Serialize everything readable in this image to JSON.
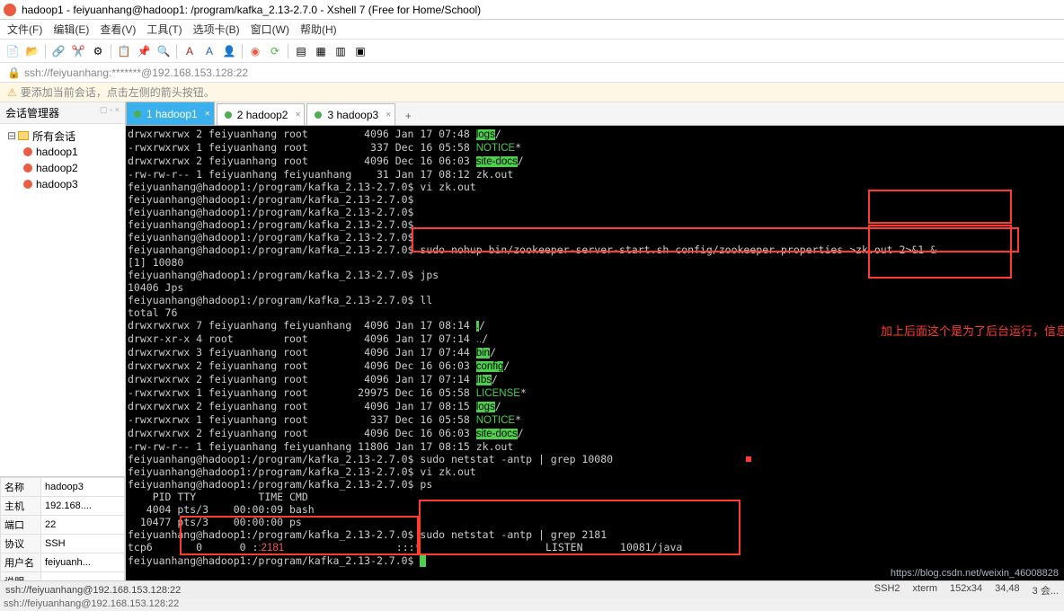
{
  "window": {
    "title": "hadoop1 - feiyuanhang@hadoop1: /program/kafka_2.13-2.7.0 - Xshell 7 (Free for Home/School)"
  },
  "menu": [
    "文件(F)",
    "编辑(E)",
    "查看(V)",
    "工具(T)",
    "选项卡(B)",
    "窗口(W)",
    "帮助(H)"
  ],
  "address": "ssh://feiyuanhang:*******@192.168.153.128:22",
  "hint": "要添加当前会话，点击左侧的箭头按钮。",
  "sidebar": {
    "title": "会话管理器",
    "root": "所有会话",
    "items": [
      "hadoop1",
      "hadoop2",
      "hadoop3"
    ]
  },
  "props": {
    "labels": {
      "name": "名称",
      "host": "主机",
      "port": "端口",
      "protocol": "协议",
      "user": "用户名",
      "desc": "说明"
    },
    "name": "hadoop3",
    "host": "192.168....",
    "port": "22",
    "protocol": "SSH",
    "user": "feiyuanh...",
    "desc": ""
  },
  "tabs": [
    {
      "label": "1 hadoop1",
      "active": true
    },
    {
      "label": "2 hadoop2",
      "active": false
    },
    {
      "label": "3 hadoop3",
      "active": false
    }
  ],
  "note": "加上后面这个是为了后台运行，信息存到out文件，如果失败就去里面查看原因",
  "terminal_lines": [
    [
      {
        "t": "drwxrwxrwx 2 feiyuanhang root         4096 Jan 17 07:48 "
      },
      {
        "t": "logs",
        "c": "gbg"
      },
      {
        "t": "/"
      }
    ],
    [
      {
        "t": "-rwxrwxrwx 1 feiyuanhang root          337 Dec 16 05:58 "
      },
      {
        "t": "NOTICE",
        "c": "g"
      },
      {
        "t": "*"
      }
    ],
    [
      {
        "t": "drwxrwxrwx 2 feiyuanhang root         4096 Dec 16 06:03 "
      },
      {
        "t": "site-docs",
        "c": "gbg"
      },
      {
        "t": "/"
      }
    ],
    [
      {
        "t": "-rw-rw-r-- 1 feiyuanhang feiyuanhang    31 Jan 17 08:12 zk.out"
      }
    ],
    [
      {
        "t": "feiyuanhang@hadoop1:/program/kafka_2.13-2.7.0$ vi zk.out"
      }
    ],
    [
      {
        "t": "feiyuanhang@hadoop1:/program/kafka_2.13-2.7.0$"
      }
    ],
    [
      {
        "t": "feiyuanhang@hadoop1:/program/kafka_2.13-2.7.0$"
      }
    ],
    [
      {
        "t": "feiyuanhang@hadoop1:/program/kafka_2.13-2.7.0$"
      }
    ],
    [
      {
        "t": "feiyuanhang@hadoop1:/program/kafka_2.13-2.7.0$"
      }
    ],
    [
      {
        "t": "feiyuanhang@hadoop1:/program/kafka_2.13-2.7.0$ sudo nohup bin/zookeeper-server-start.sh config/zookeeper.properties >zk.out 2>&1 &"
      }
    ],
    [
      {
        "t": "[1] 10080"
      }
    ],
    [
      {
        "t": "feiyuanhang@hadoop1:/program/kafka_2.13-2.7.0$ jps"
      }
    ],
    [
      {
        "t": "10406 Jps"
      }
    ],
    [
      {
        "t": "feiyuanhang@hadoop1:/program/kafka_2.13-2.7.0$ ll"
      }
    ],
    [
      {
        "t": "total 76"
      }
    ],
    [
      {
        "t": "drwxrwxrwx 7 feiyuanhang feiyuanhang  4096 Jan 17 08:14 "
      },
      {
        "t": ".",
        "c": "gbg"
      },
      {
        "t": "/"
      }
    ],
    [
      {
        "t": "drwxr-xr-x 4 root        root         4096 Jan 17 07:14 "
      },
      {
        "t": "..",
        "c": "c"
      },
      {
        "t": "/"
      }
    ],
    [
      {
        "t": "drwxrwxrwx 3 feiyuanhang root         4096 Jan 17 07:44 "
      },
      {
        "t": "bin",
        "c": "gbg"
      },
      {
        "t": "/"
      }
    ],
    [
      {
        "t": "drwxrwxrwx 2 feiyuanhang root         4096 Dec 16 06:03 "
      },
      {
        "t": "config",
        "c": "gbg"
      },
      {
        "t": "/"
      }
    ],
    [
      {
        "t": "drwxrwxrwx 2 feiyuanhang root         4096 Jan 17 07:14 "
      },
      {
        "t": "libs",
        "c": "gbg"
      },
      {
        "t": "/"
      }
    ],
    [
      {
        "t": "-rwxrwxrwx 1 feiyuanhang root        29975 Dec 16 05:58 "
      },
      {
        "t": "LICENSE",
        "c": "g"
      },
      {
        "t": "*"
      }
    ],
    [
      {
        "t": "drwxrwxrwx 2 feiyuanhang root         4096 Jan 17 08:15 "
      },
      {
        "t": "logs",
        "c": "gbg"
      },
      {
        "t": "/"
      }
    ],
    [
      {
        "t": "-rwxrwxrwx 1 feiyuanhang root          337 Dec 16 05:58 "
      },
      {
        "t": "NOTICE",
        "c": "g"
      },
      {
        "t": "*"
      }
    ],
    [
      {
        "t": "drwxrwxrwx 2 feiyuanhang root         4096 Dec 16 06:03 "
      },
      {
        "t": "site-docs",
        "c": "gbg"
      },
      {
        "t": "/"
      }
    ],
    [
      {
        "t": "-rw-rw-r-- 1 feiyuanhang feiyuanhang 11806 Jan 17 08:15 zk.out"
      }
    ],
    [
      {
        "t": "feiyuanhang@hadoop1:/program/kafka_2.13-2.7.0$ sudo netstat -antp | grep 10080"
      }
    ],
    [
      {
        "t": "feiyuanhang@hadoop1:/program/kafka_2.13-2.7.0$ vi zk.out"
      }
    ],
    [
      {
        "t": "feiyuanhang@hadoop1:/program/kafka_2.13-2.7.0$ ps"
      }
    ],
    [
      {
        "t": "    PID TTY          TIME CMD"
      }
    ],
    [
      {
        "t": "   4004 pts/3    00:00:09 bash"
      }
    ],
    [
      {
        "t": "  10477 pts/3    00:00:00 ps"
      }
    ],
    [
      {
        "t": "feiyuanhang@hadoop1:/program/kafka_2.13-2.7.0$ sudo netstat -antp | grep 2181"
      }
    ],
    [
      {
        "t": "tcp6       0      0 :"
      },
      {
        "t": ":2181",
        "c": "r"
      },
      {
        "t": "                  :::*                    LISTEN      10081/java"
      }
    ],
    [
      {
        "t": "feiyuanhang@hadoop1:/program/kafka_2.13-2.7.0$ "
      },
      {
        "cur": true
      }
    ]
  ],
  "status": {
    "left": "ssh://feiyuanhang@192.168.153.128:22",
    "right": [
      "SSH2",
      "xterm",
      "152x34",
      "34,48",
      "3 会..."
    ]
  },
  "watermark": "https://blog.csdn.net/weixin_46008828"
}
